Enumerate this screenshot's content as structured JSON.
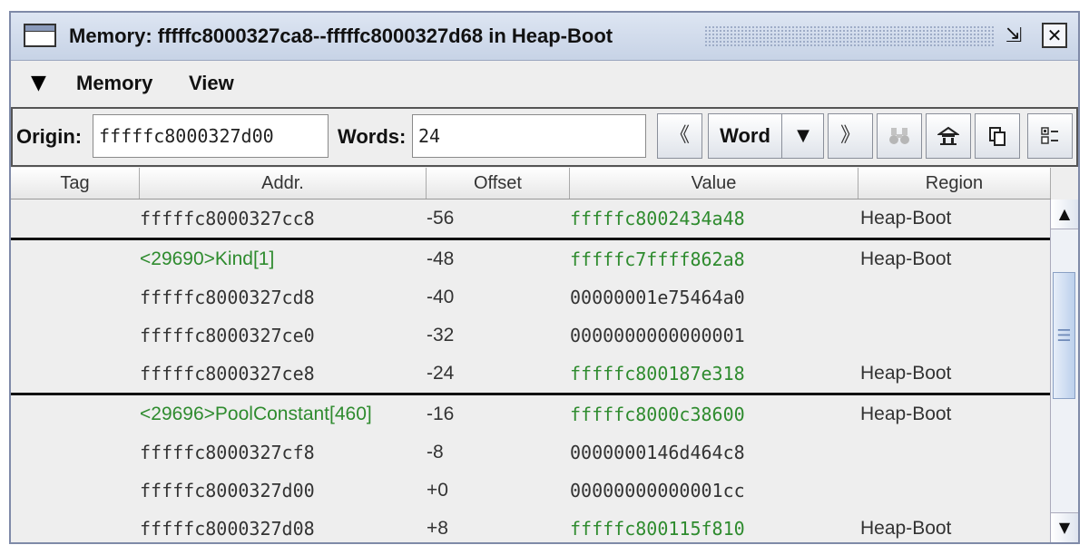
{
  "window": {
    "title": "Memory: fffffc8000327ca8--fffffc8000327d68 in Heap-Boot",
    "restore_glyph": "⇲",
    "close_glyph": "✕"
  },
  "menu": {
    "dropdown_glyph": "▼",
    "items": [
      "Memory",
      "View"
    ]
  },
  "toolbar": {
    "origin_label": "Origin:",
    "origin_value": "fffffc8000327d00",
    "words_label": "Words:",
    "words_value": "24",
    "prev_glyph": "《",
    "unit_value": "Word",
    "unit_arrow": "▼",
    "next_glyph": "》",
    "find_icon": "binoculars-icon",
    "home_icon": "home-icon",
    "copy_icon": "copy-icon",
    "columns_icon": "columns-icon"
  },
  "table": {
    "columns": [
      "Tag",
      "Addr.",
      "Offset",
      "Value",
      "Region"
    ],
    "rows": [
      {
        "tag": "",
        "addr": "fffffc8000327cc8",
        "offset": "-56",
        "value": "fffffc8002434a48",
        "region": "Heap-Boot",
        "value_link": true,
        "addr_link": false,
        "separator": false
      },
      {
        "tag": "",
        "addr": "<29690>Kind[1]",
        "offset": "-48",
        "value": "fffffc7ffff862a8",
        "region": "Heap-Boot",
        "value_link": true,
        "addr_link": true,
        "separator": true
      },
      {
        "tag": "",
        "addr": "fffffc8000327cd8",
        "offset": "-40",
        "value": "00000001e75464a0",
        "region": "",
        "value_link": false,
        "addr_link": false,
        "separator": false
      },
      {
        "tag": "",
        "addr": "fffffc8000327ce0",
        "offset": "-32",
        "value": "0000000000000001",
        "region": "",
        "value_link": false,
        "addr_link": false,
        "separator": false
      },
      {
        "tag": "",
        "addr": "fffffc8000327ce8",
        "offset": "-24",
        "value": "fffffc800187e318",
        "region": "Heap-Boot",
        "value_link": true,
        "addr_link": false,
        "separator": false
      },
      {
        "tag": "",
        "addr": "<29696>PoolConstant[460]",
        "offset": "-16",
        "value": "fffffc8000c38600",
        "region": "Heap-Boot",
        "value_link": true,
        "addr_link": true,
        "separator": true
      },
      {
        "tag": "",
        "addr": "fffffc8000327cf8",
        "offset": "-8",
        "value": "0000000146d464c8",
        "region": "",
        "value_link": false,
        "addr_link": false,
        "separator": false
      },
      {
        "tag": "",
        "addr": "fffffc8000327d00",
        "offset": "+0",
        "value": "00000000000001cc",
        "region": "",
        "value_link": false,
        "addr_link": false,
        "separator": false
      },
      {
        "tag": "",
        "addr": "fffffc8000327d08",
        "offset": "+8",
        "value": "fffffc800115f810",
        "region": "Heap-Boot",
        "value_link": true,
        "addr_link": false,
        "separator": false
      }
    ]
  },
  "scrollbar": {
    "up_glyph": "▲",
    "down_glyph": "▼",
    "grip_glyph": "☰"
  },
  "colors": {
    "link": "#2e8b2e",
    "title_bar": "#c7d3e6",
    "separator": "#111111"
  }
}
